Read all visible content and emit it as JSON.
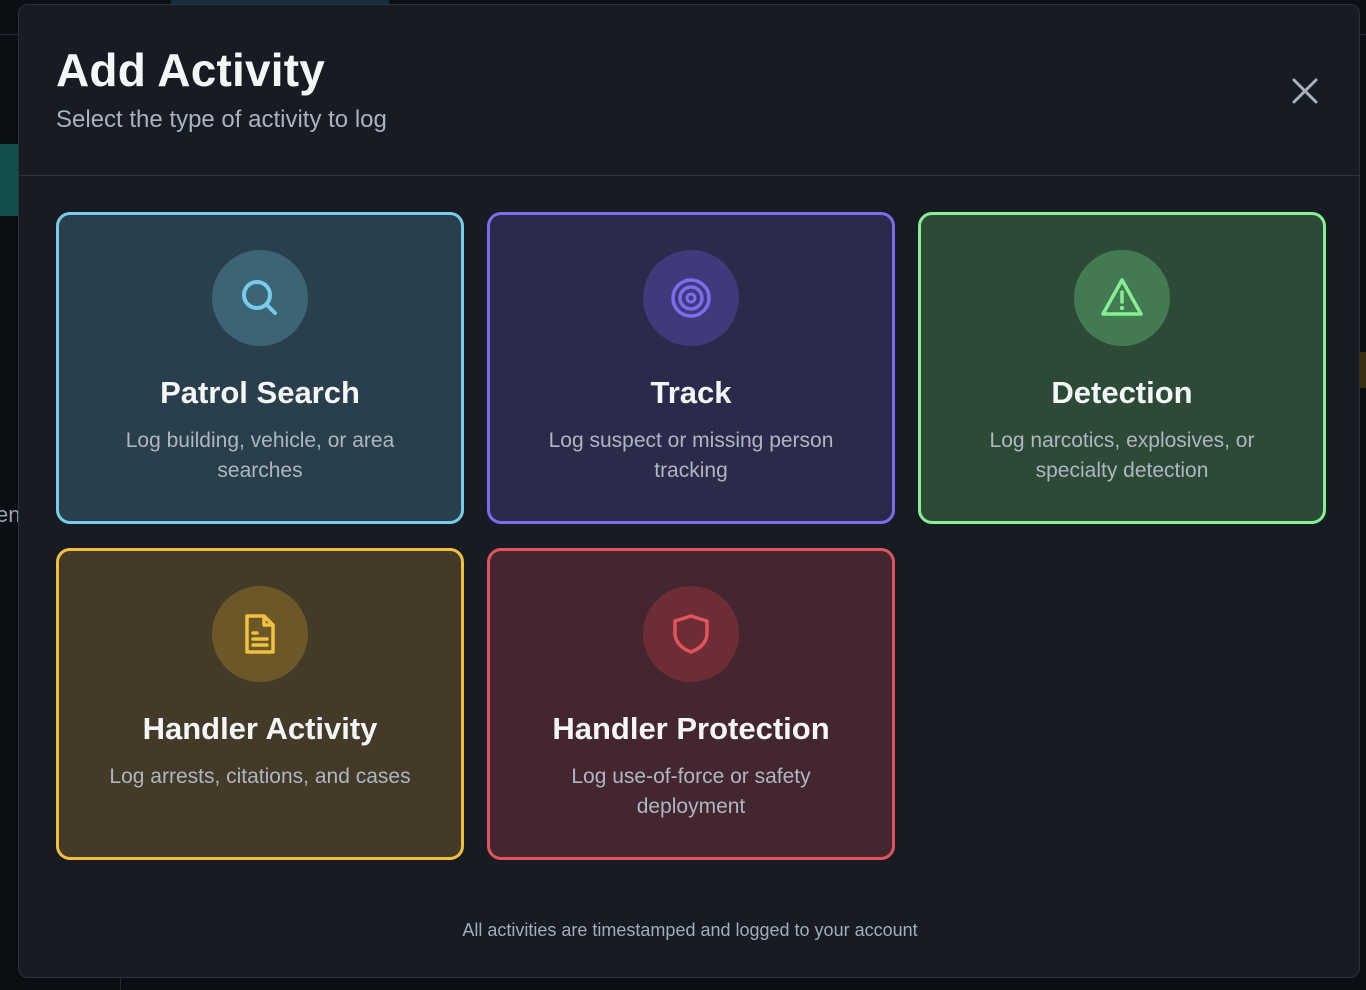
{
  "modal": {
    "title": "Add Activity",
    "subtitle": "Select the type of activity to log",
    "close_icon": "close-icon",
    "footer_note": "All activities are timestamped and logged to your account"
  },
  "background": {
    "partial_text": "en"
  },
  "activities": [
    {
      "title": "Patrol Search",
      "description": "Log building, vehicle, or area searches",
      "icon": "search-icon",
      "accent": "#78cbeb"
    },
    {
      "title": "Track",
      "description": "Log suspect or missing person tracking",
      "icon": "target-icon",
      "accent": "#7b6cf0"
    },
    {
      "title": "Detection",
      "description": "Log narcotics, explosives, or specialty detection",
      "icon": "warning-icon",
      "accent": "#86ef92"
    },
    {
      "title": "Handler Activity",
      "description": "Log arrests, citations, and cases",
      "icon": "document-icon",
      "accent": "#f0c041"
    },
    {
      "title": "Handler Protection",
      "description": "Log use-of-force or safety deployment",
      "icon": "shield-icon",
      "accent": "#e2535b"
    }
  ]
}
